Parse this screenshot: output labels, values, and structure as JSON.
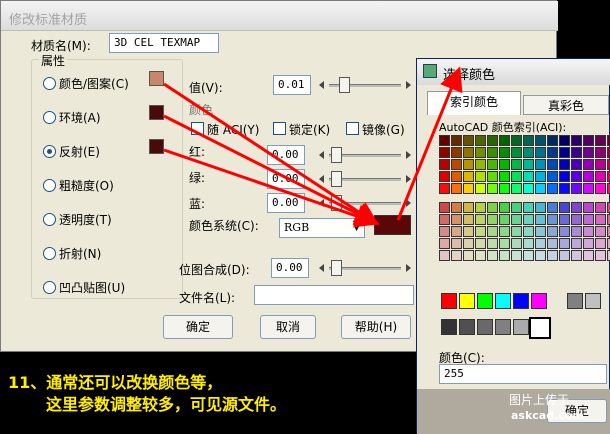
{
  "main_dialog": {
    "title": "修改标准材质",
    "material_name_label": "材质名(M):",
    "material_name_value": "3D CEL TEXMAP",
    "attributes_label": "属性",
    "attributes": [
      {
        "label": "颜色/图案(C)",
        "selected": false,
        "swatch": "#c8876a"
      },
      {
        "label": "环境(A)",
        "selected": false,
        "swatch": "#4a0a0a"
      },
      {
        "label": "反射(E)",
        "selected": true,
        "swatch": "#4a0a0a"
      },
      {
        "label": "粗糙度(O)",
        "selected": false
      },
      {
        "label": "透明度(T)",
        "selected": false
      },
      {
        "label": "折射(N)",
        "selected": false
      },
      {
        "label": "凹凸贴图(U)",
        "selected": false
      }
    ],
    "value_label": "值(V):",
    "value": "0.01",
    "color_label": "颜色",
    "checks": [
      {
        "label": "随 ACI(Y)",
        "checked": false
      },
      {
        "label": "锁定(K)",
        "checked": false
      },
      {
        "label": "镜像(G)",
        "checked": false
      }
    ],
    "red_label": "红:",
    "red_value": "0.00",
    "green_label": "绿:",
    "green_value": "0.00",
    "blue_label": "蓝:",
    "blue_value": "0.00",
    "color_system_label": "颜色系统(C):",
    "color_system_value": "RGB",
    "preview_color": "#5c0707",
    "bitmap_blend_label": "位图合成(D):",
    "bitmap_blend_value": "0.00",
    "filename_label": "文件名(L):",
    "filename_value": "",
    "ok_label": "确定",
    "cancel_label": "取消",
    "help_label": "帮助(H)"
  },
  "picker": {
    "title": "选择颜色",
    "tab_index": "索引颜色",
    "tab_true": "真彩色",
    "index_label": "AutoCAD 颜色索引(ACI):",
    "color_label": "颜色(C):",
    "color_value": "255",
    "ok_label": "确定",
    "standard_colors": [
      "#ff0000",
      "#ffff00",
      "#00ff00",
      "#00ffff",
      "#0000ff",
      "#ff00ff",
      "#ffffff",
      "#808080",
      "#c0c0c0"
    ],
    "grays": [
      "#333333",
      "#505050",
      "#696969",
      "#808080",
      "#aaaaaa",
      "#ffffff"
    ]
  },
  "caption": {
    "line1": "11、通常还可以改换颜色等，",
    "line2": "这里参数调整较多，可见源文件。"
  },
  "watermark": {
    "line1": "图片上传于",
    "line2": "askcad.com"
  },
  "colors": {
    "arrow": "#ff0000",
    "caption": "#ffee00"
  }
}
